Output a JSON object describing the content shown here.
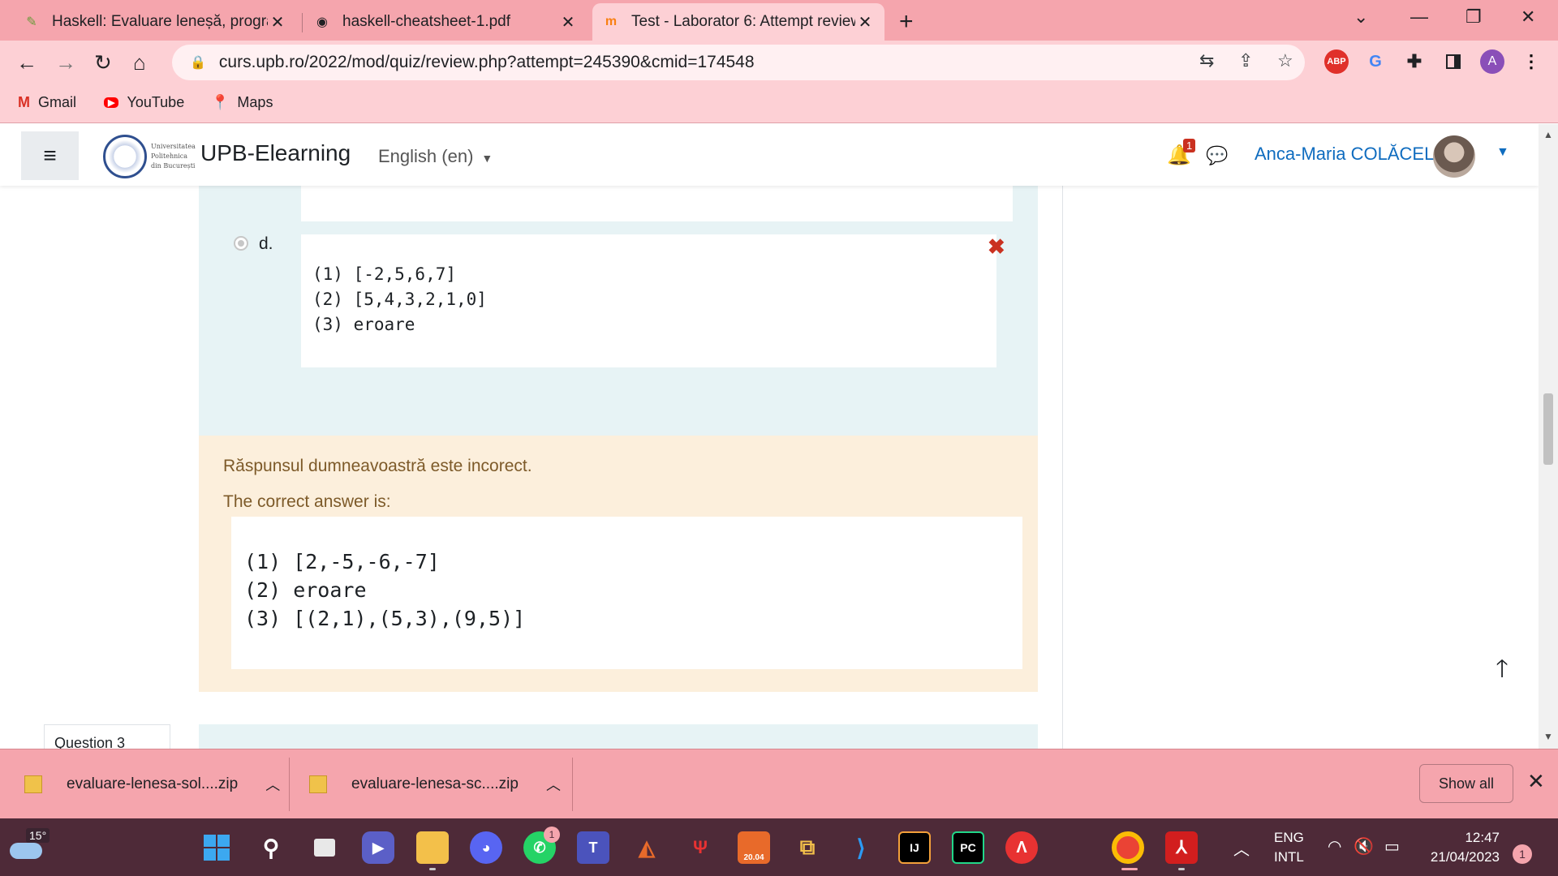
{
  "browser": {
    "tabs": [
      {
        "title": "Haskell: Evaluare leneșă, program",
        "icon": "haskell-icon"
      },
      {
        "title": "haskell-cheatsheet-1.pdf",
        "icon": "globe-icon"
      },
      {
        "title": "Test - Laborator 6: Attempt review",
        "icon": "moodle-icon"
      }
    ],
    "url": "curs.upb.ro/2022/mod/quiz/review.php?attempt=245390&cmid=174548",
    "bookmarks": [
      "Gmail",
      "YouTube",
      "Maps"
    ],
    "extensions": {
      "abp": "ABP",
      "profile": "A"
    }
  },
  "moodle": {
    "logo_text": [
      "Universitatea",
      "Politehnica",
      "din București"
    ],
    "site_name": "UPB-Elearning",
    "language": "English (en)",
    "notifications_count": "1",
    "username": "Anca-Maria COLĂCEL"
  },
  "question": {
    "option_label": "d.",
    "option_lines": [
      "(1) [-2,5,6,7]",
      "(2) [5,4,3,2,1,0]",
      "(3) eroare"
    ],
    "wrong_mark": "✖",
    "progress_fraction": 0.98
  },
  "feedback": {
    "message": "Răspunsul dumneavoastră este incorect.",
    "correct_label": "The correct answer is:",
    "correct_lines": [
      "(1) [2,-5,-6,-7]",
      "(2) eroare",
      "(3) [(2,1),(5,3),(9,5)]"
    ]
  },
  "next_question": {
    "label": "Question 3"
  },
  "downloads": {
    "items": [
      "evaluare-lenesa-sol....zip",
      "evaluare-lenesa-sc....zip"
    ],
    "show_all": "Show all"
  },
  "taskbar": {
    "weather_temp": "15°",
    "whatsapp_badge": "1",
    "ubuntu_label": "20.04",
    "intellij_label": "IJ",
    "pycharm_label": "PC",
    "language": [
      "ENG",
      "INTL"
    ],
    "time": "12:47",
    "date": "21/04/2023",
    "notification_count": "1"
  }
}
